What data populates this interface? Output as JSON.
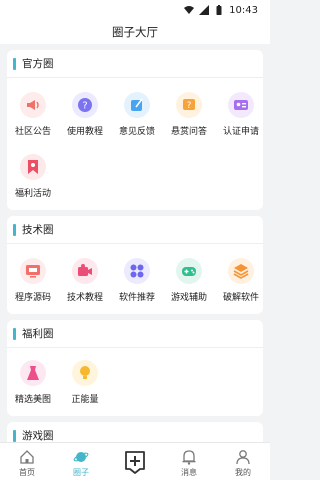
{
  "status_bar": {
    "time": "10:43",
    "icons": [
      "wifi-icon",
      "signal-icon",
      "battery-icon"
    ]
  },
  "header": {
    "title": "圈子大厅"
  },
  "colors": {
    "accent": "#45b6c9",
    "background": "#f2f3f5"
  },
  "sections": [
    {
      "title": "官方圈",
      "items": [
        {
          "label": "社区公告",
          "icon": "megaphone-icon"
        },
        {
          "label": "使用教程",
          "icon": "question-icon"
        },
        {
          "label": "意见反馈",
          "icon": "edit-icon"
        },
        {
          "label": "悬赏问答",
          "icon": "question-box-icon"
        },
        {
          "label": "认证申请",
          "icon": "id-card-icon"
        },
        {
          "label": "福利活动",
          "icon": "bookmark-icon"
        }
      ]
    },
    {
      "title": "技术圈",
      "items": [
        {
          "label": "程序源码",
          "icon": "monitor-icon"
        },
        {
          "label": "技术教程",
          "icon": "video-icon"
        },
        {
          "label": "软件推荐",
          "icon": "apps-icon"
        },
        {
          "label": "游戏辅助",
          "icon": "gamepad-icon"
        },
        {
          "label": "破解软件",
          "icon": "layers-icon"
        }
      ]
    },
    {
      "title": "福利圈",
      "items": [
        {
          "label": "精选美图",
          "icon": "dress-icon"
        },
        {
          "label": "正能量",
          "icon": "bulb-icon"
        }
      ]
    },
    {
      "title": "游戏圈",
      "items": []
    }
  ],
  "tabbar": [
    {
      "label": "首页",
      "icon": "home-icon",
      "active": false
    },
    {
      "label": "圈子",
      "icon": "planet-icon",
      "active": true
    },
    {
      "label": "",
      "icon": "post-add-icon",
      "active": false
    },
    {
      "label": "消息",
      "icon": "bell-icon",
      "active": false
    },
    {
      "label": "我的",
      "icon": "user-icon",
      "active": false
    }
  ]
}
